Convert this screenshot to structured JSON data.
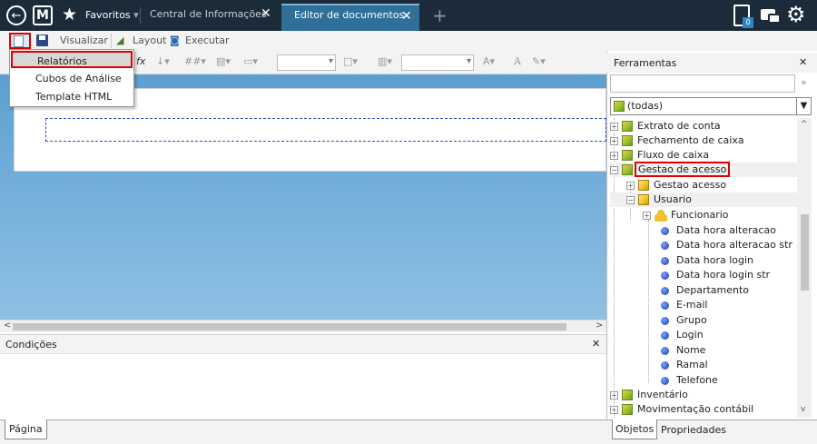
{
  "titlebar": {
    "favorites_label": "Favoritos",
    "tabs": [
      {
        "label": "Central de Informações"
      },
      {
        "label": "Editor de documentos"
      }
    ]
  },
  "toolbar": {
    "visualize_label": "Visualizar",
    "layout_label": "Layout",
    "execute_label": "Executar"
  },
  "menu": {
    "items": [
      {
        "label": "Relatórios"
      },
      {
        "label": "Cubos de Análise"
      },
      {
        "label": "Template HTML"
      }
    ]
  },
  "conditions": {
    "title": "Condições",
    "tab_label": "Página"
  },
  "tools_panel": {
    "title": "Ferramentas",
    "filter_value": "(todas)",
    "tree": [
      {
        "label": "Extrato de conta"
      },
      {
        "label": "Fechamento de caixa"
      },
      {
        "label": "Fluxo de caixa"
      },
      {
        "label": "Gestao de acesso"
      },
      {
        "label": "Gestao acesso"
      },
      {
        "label": "Usuario"
      },
      {
        "label": "Funcionario"
      },
      {
        "label": "Data hora alteracao"
      },
      {
        "label": "Data hora alteracao str"
      },
      {
        "label": "Data hora login"
      },
      {
        "label": "Data hora login str"
      },
      {
        "label": "Departamento"
      },
      {
        "label": "E-mail"
      },
      {
        "label": "Grupo"
      },
      {
        "label": "Login"
      },
      {
        "label": "Nome"
      },
      {
        "label": "Ramal"
      },
      {
        "label": "Telefone"
      },
      {
        "label": "Inventário"
      },
      {
        "label": "Movimentação contábil"
      }
    ],
    "tabs": [
      {
        "label": "Objetos"
      },
      {
        "label": "Propriedades"
      }
    ]
  },
  "notification_badge": "0"
}
